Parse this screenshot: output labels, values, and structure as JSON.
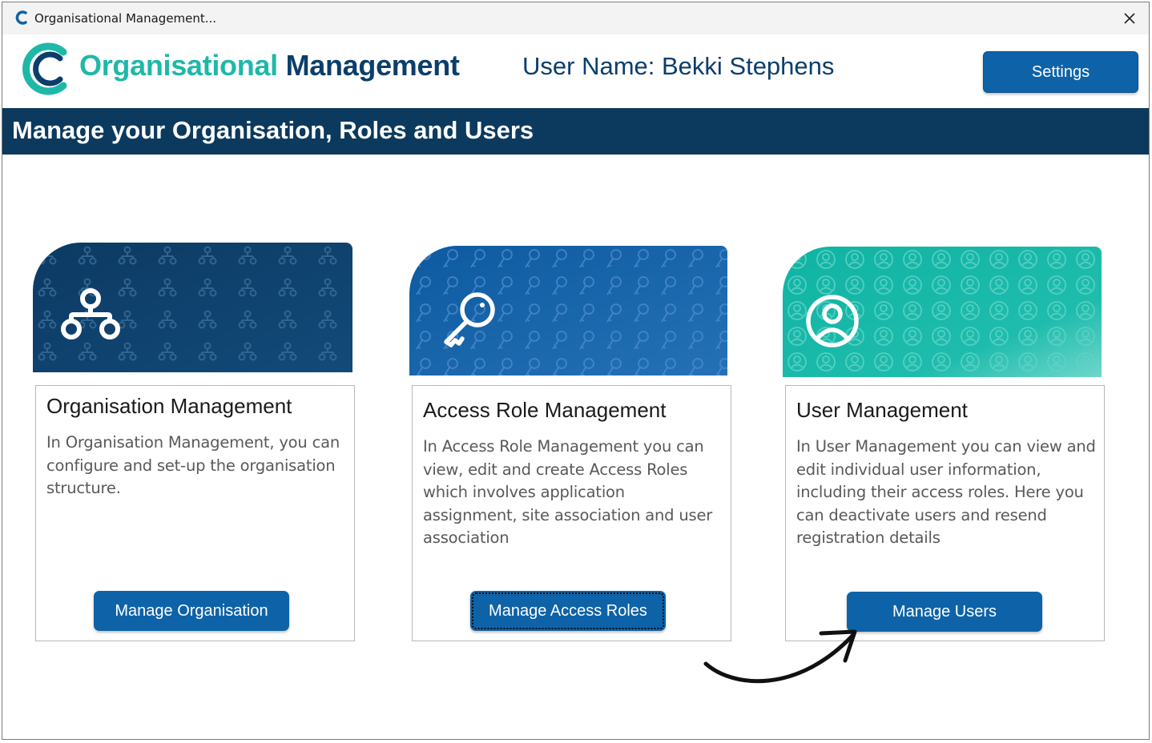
{
  "window": {
    "title": "Organisational Management...",
    "icons": {
      "app": "app-c-logo-icon",
      "close": "close-icon"
    }
  },
  "header": {
    "brand_part1": "Organisational",
    "brand_part2": "Management",
    "username": "User Name: Bekki Stephens",
    "settings_label": "Settings"
  },
  "banner": {
    "text": "Manage your Organisation, Roles and Users"
  },
  "cards": [
    {
      "icon": "hierarchy-icon",
      "title": "Organisation Management",
      "description": "In Organisation Management, you can configure and set-up the organisation structure.",
      "button_label": "Manage Organisation"
    },
    {
      "icon": "key-icon",
      "title": "Access Role Management",
      "description": "In Access Role Management you can view, edit and create Access Roles which involves application assignment, site association and user association",
      "button_label": "Manage Access Roles"
    },
    {
      "icon": "user-circle-icon",
      "title": "User Management",
      "description": "In User Management you can view and edit  individual user information, including their access roles. Here you can deactivate users and resend registration details",
      "button_label": "Manage Users"
    }
  ],
  "colors": {
    "brand_teal": "#1fb8a8",
    "brand_navy": "#0b3e6b",
    "button_blue": "#0e63a8",
    "banner_navy": "#0b3a5e"
  }
}
